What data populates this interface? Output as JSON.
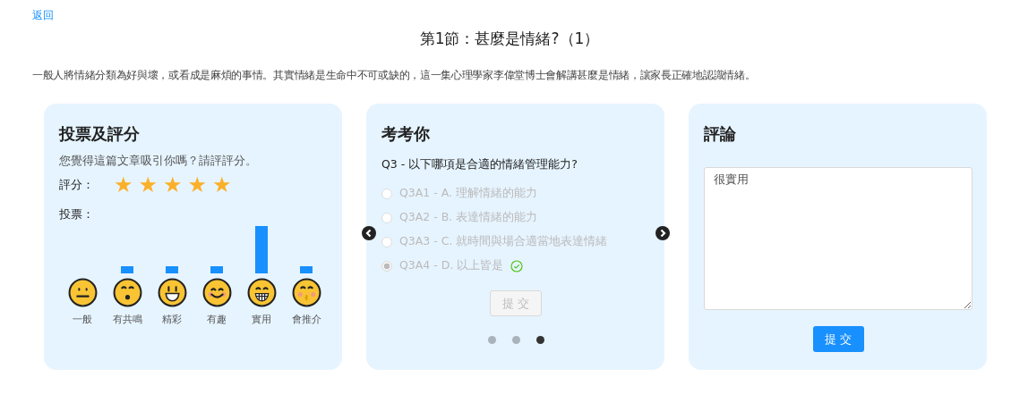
{
  "back_link": "返回",
  "title": "第1節：甚麼是情緒?（1）",
  "description": "一般人將情緒分類為好與壞，或看成是麻煩的事情。其實情緒是生命中不可或缺的，這一集心理學家李偉堂博士會解講甚麼是情緒，讓家長正確地認識情緒。",
  "vote_card": {
    "title": "投票及評分",
    "prompt": "您覺得這篇文章吸引你嗎？請評評分。",
    "rating_label": "評分：",
    "stars": 5,
    "votes_label": "投票：",
    "votes": [
      {
        "label": "一般",
        "kind": "neutral"
      },
      {
        "label": "有共鳴",
        "kind": "surprised"
      },
      {
        "label": "精彩",
        "kind": "grin"
      },
      {
        "label": "有趣",
        "kind": "smile"
      },
      {
        "label": "實用",
        "kind": "grinning"
      },
      {
        "label": "會推介",
        "kind": "kiss"
      }
    ]
  },
  "quiz_card": {
    "title": "考考你",
    "question": "Q3 - 以下哪項是合適的情緒管理能力?",
    "options": [
      {
        "label": "Q3A1 - A. 理解情緒的能力",
        "selected": false,
        "disabled": true,
        "correct": false
      },
      {
        "label": "Q3A2 - B. 表達情緒的能力",
        "selected": false,
        "disabled": true,
        "correct": false
      },
      {
        "label": "Q3A3 - C. 就時間與場合適當地表達情緒",
        "selected": false,
        "disabled": true,
        "correct": false
      },
      {
        "label": "Q3A4 - D. 以上皆是",
        "selected": true,
        "disabled": true,
        "correct": true
      }
    ],
    "submit": {
      "label": "提 交",
      "disabled": true
    },
    "pages": [
      {
        "selected": false
      },
      {
        "selected": false
      },
      {
        "selected": true
      }
    ]
  },
  "comment_card": {
    "title": "評論",
    "value": "很實用",
    "submit": "提 交"
  }
}
